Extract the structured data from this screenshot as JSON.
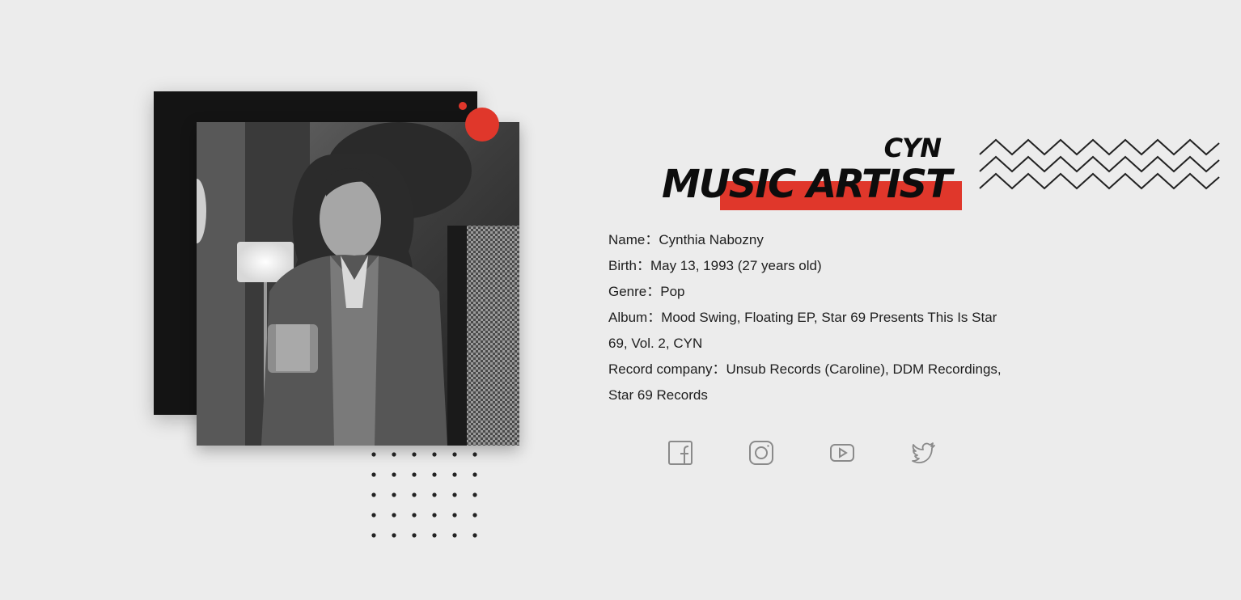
{
  "header": {
    "subtitle": "CYN",
    "title": "MUSIC ARTIST"
  },
  "info": [
    {
      "label": "Name",
      "sep": "：",
      "value": "Cynthia Nabozny"
    },
    {
      "label": "Birth",
      "sep": "：",
      "value": "May 13, 1993 (27 years old)"
    },
    {
      "label": "Genre",
      "sep": "：",
      "value": "Pop"
    },
    {
      "label": "Album",
      "sep": "：",
      "value": "Mood Swing, Floating EP, Star 69 Presents This Is Star 69, Vol. 2, CYN"
    },
    {
      "label": "Record company",
      "sep": "：",
      "value": "Unsub Records (Caroline), DDM Recordings, Star 69 Records"
    }
  ],
  "social": [
    {
      "name": "facebook-icon"
    },
    {
      "name": "instagram-icon"
    },
    {
      "name": "youtube-icon"
    },
    {
      "name": "twitter-icon"
    }
  ],
  "colors": {
    "accent": "#e0372b",
    "background": "#ececec",
    "dark": "#141414",
    "icon": "#8a8a8a"
  }
}
